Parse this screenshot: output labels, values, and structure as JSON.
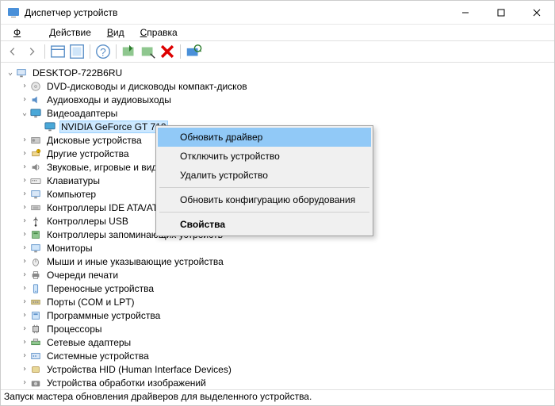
{
  "title": "Диспетчер устройств",
  "menu": {
    "file": "Файл",
    "action": "Действие",
    "view": "Вид",
    "help": "Справка"
  },
  "root": "DESKTOP-722B6RU",
  "nodes": [
    {
      "label": "DVD-дисководы и дисководы компакт-дисков",
      "icon": "disc"
    },
    {
      "label": "Аудиовходы и аудиовыходы",
      "icon": "audio"
    },
    {
      "label": "Видеоадаптеры",
      "icon": "display",
      "expanded": true,
      "children": [
        {
          "label": "NVIDIA GeForce GT 710",
          "icon": "display",
          "selected": true
        }
      ]
    },
    {
      "label": "Дисковые устройства",
      "icon": "hdd"
    },
    {
      "label": "Другие устройства",
      "icon": "other"
    },
    {
      "label": "Звуковые, игровые и виде",
      "icon": "sound"
    },
    {
      "label": "Клавиатуры",
      "icon": "keyboard"
    },
    {
      "label": "Компьютер",
      "icon": "computer"
    },
    {
      "label": "Контроллеры IDE ATA/AT,",
      "icon": "ide"
    },
    {
      "label": "Контроллеры USB",
      "icon": "usb"
    },
    {
      "label": "Контроллеры запоминающих устройств",
      "icon": "storage"
    },
    {
      "label": "Мониторы",
      "icon": "monitor"
    },
    {
      "label": "Мыши и иные указывающие устройства",
      "icon": "mouse"
    },
    {
      "label": "Очереди печати",
      "icon": "print"
    },
    {
      "label": "Переносные устройства",
      "icon": "portable"
    },
    {
      "label": "Порты (COM и LPT)",
      "icon": "port"
    },
    {
      "label": "Программные устройства",
      "icon": "software"
    },
    {
      "label": "Процессоры",
      "icon": "cpu"
    },
    {
      "label": "Сетевые адаптеры",
      "icon": "network"
    },
    {
      "label": "Системные устройства",
      "icon": "system"
    },
    {
      "label": "Устройства HID (Human Interface Devices)",
      "icon": "hid"
    },
    {
      "label": "Устройства обработки изображений",
      "icon": "camera"
    }
  ],
  "context": {
    "update": "Обновить драйвер",
    "disable": "Отключить устройство",
    "uninstall": "Удалить устройство",
    "scan": "Обновить конфигурацию оборудования",
    "properties": "Свойства"
  },
  "status": "Запуск мастера обновления драйверов для выделенного устройства."
}
